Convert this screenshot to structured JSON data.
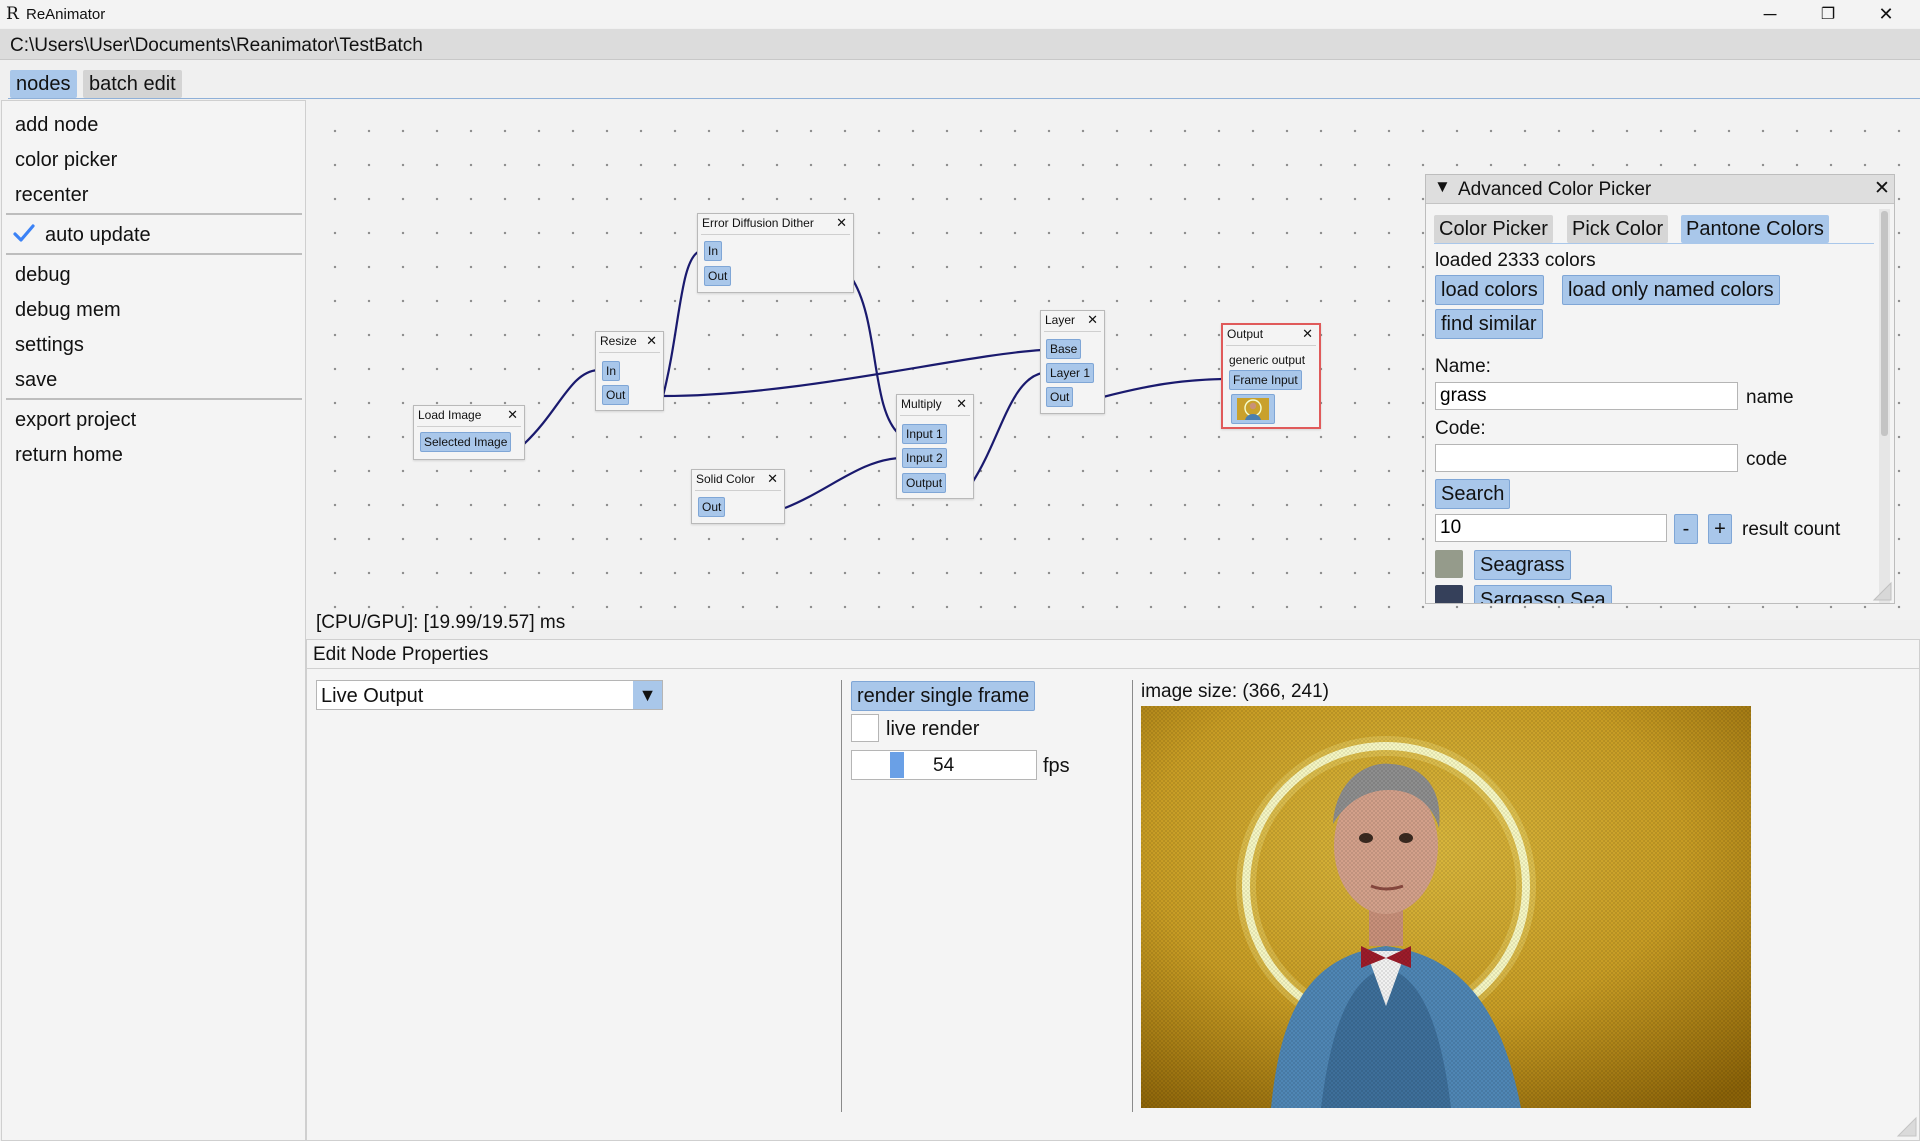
{
  "window": {
    "icon_glyph": "R",
    "title": "ReAnimator",
    "controls": {
      "minimize": "─",
      "restore": "❐",
      "close": "✕"
    }
  },
  "path": "C:\\Users\\User\\Documents\\Reanimator\\TestBatch",
  "tabs": [
    {
      "label": "nodes",
      "active": true
    },
    {
      "label": "batch edit",
      "active": false
    }
  ],
  "menu": {
    "add_node": "add node",
    "color_picker": "color picker",
    "recenter": "recenter",
    "auto_update": {
      "label": "auto update",
      "checked": true
    },
    "debug": "debug",
    "debug_mem": "debug mem",
    "settings": "settings",
    "save": "save",
    "export_project": "export project",
    "return_home": "return home"
  },
  "nodes": {
    "load_image": {
      "title": "Load Image",
      "pins": [
        "Selected Image"
      ]
    },
    "resize": {
      "title": "Resize",
      "pins": [
        "In",
        "Out"
      ]
    },
    "error_diffusion": {
      "title": "Error Diffusion Dither",
      "pins": [
        "In",
        "Out"
      ]
    },
    "solid_color": {
      "title": "Solid Color",
      "pins": [
        "Out"
      ]
    },
    "multiply": {
      "title": "Multiply",
      "pins": [
        "Input 1",
        "Input 2",
        "Output"
      ]
    },
    "layer": {
      "title": "Layer",
      "pins": [
        "Base",
        "Layer 1",
        "Out"
      ]
    },
    "output": {
      "title": "Output",
      "text": "generic output",
      "pins": [
        "Frame Input"
      ]
    },
    "close_glyph": "✕"
  },
  "perf": "[CPU/GPU]: [19.99/19.57] ms",
  "color_picker": {
    "title": "Advanced Color Picker",
    "collapse_glyph": "▼",
    "close_glyph": "✕",
    "tabs": [
      {
        "label": "Color Picker",
        "active": false
      },
      {
        "label": "Pick Color",
        "active": false
      },
      {
        "label": "Pantone Colors",
        "active": true
      }
    ],
    "status": "loaded 2333 colors",
    "load_colors": "load colors",
    "load_named": "load only named colors",
    "find_similar": "find similar",
    "name_label": "Name:",
    "name_value": "grass",
    "name_suffix": "name",
    "code_label": "Code:",
    "code_value": "",
    "code_suffix": "code",
    "search": "Search",
    "result_count": "10",
    "minus": "-",
    "plus": "+",
    "result_label": "result count",
    "results": [
      {
        "name": "Seagrass",
        "color": "#959b8b"
      },
      {
        "name": "Sargasso Sea",
        "color": "#35405a"
      }
    ]
  },
  "edit": {
    "title": "Edit Node Properties",
    "output_mode": "Live Output",
    "dropdown_arrow": "▼",
    "render_single": "render single frame",
    "live_render": {
      "label": "live render",
      "checked": false
    },
    "fps": {
      "value": "54",
      "label": "fps",
      "fraction": 0.22
    },
    "image_size": "image size: (366, 241)"
  },
  "colors": {
    "accent": "#a9c7ea",
    "accent_border": "#7fa6d6",
    "wire": "#1a1a6e",
    "output_border": "#e05a5a",
    "check": "#3b82f6"
  }
}
